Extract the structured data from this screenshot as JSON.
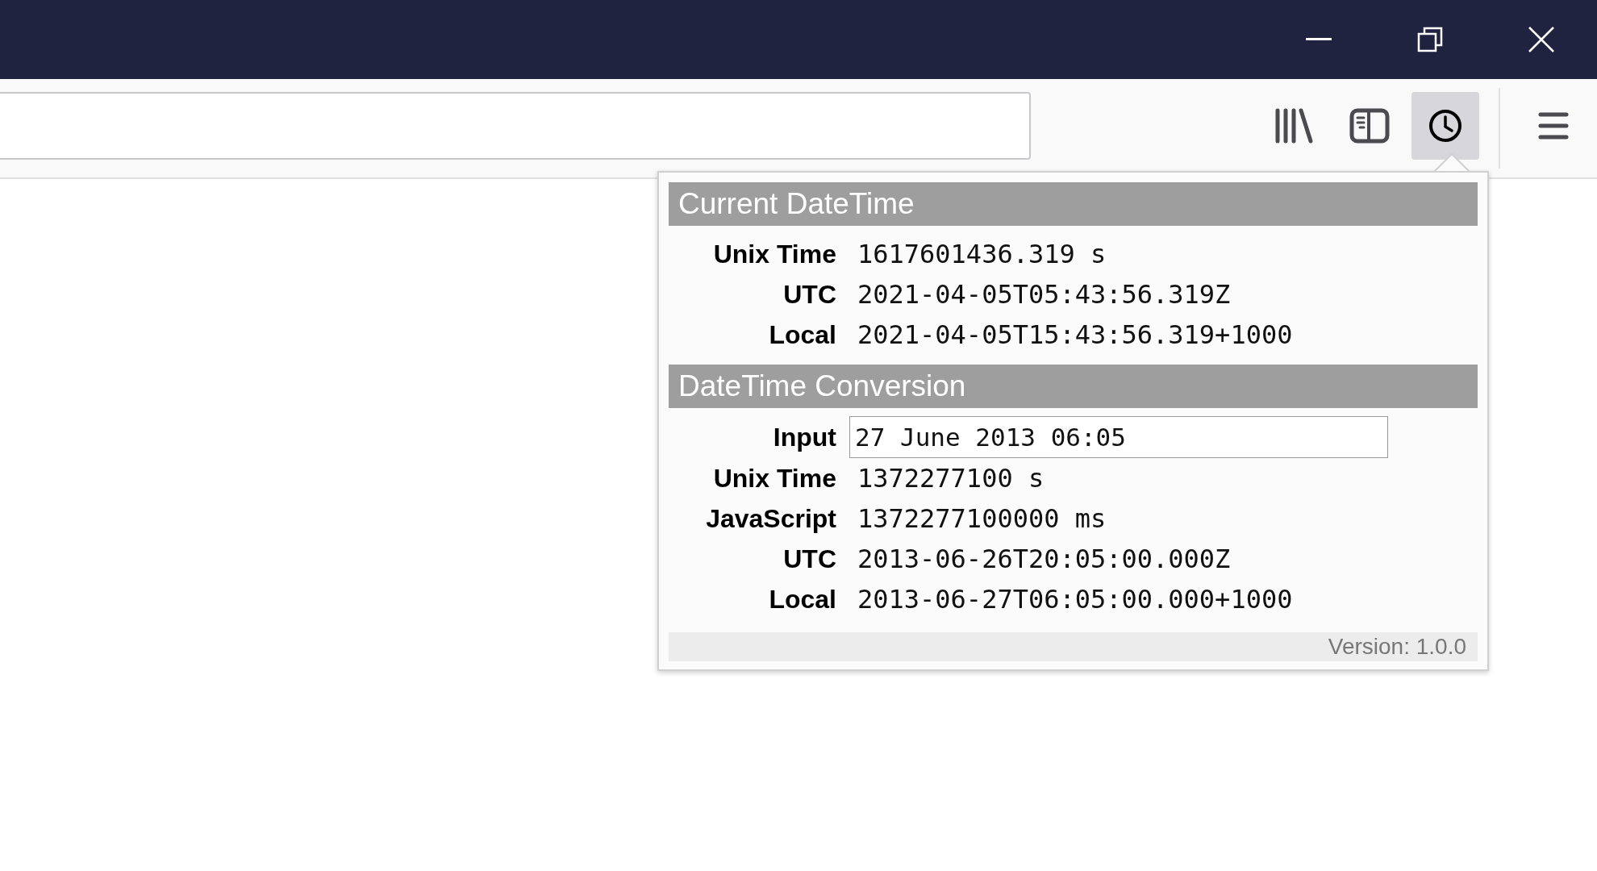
{
  "toolbar": {
    "buttons": [
      {
        "kind": "library",
        "selected": false
      },
      {
        "kind": "sidebar",
        "selected": false
      },
      {
        "kind": "clock",
        "selected": true
      }
    ]
  },
  "popup": {
    "sections": [
      {
        "title": "Current DateTime",
        "rows": [
          {
            "kind": "text",
            "label": "Unix Time",
            "value": "1617601436.319 s"
          },
          {
            "kind": "text",
            "label": "UTC",
            "value": "2021-04-05T05:43:56.319Z"
          },
          {
            "kind": "text",
            "label": "Local",
            "value": "2021-04-05T15:43:56.319+1000"
          }
        ]
      },
      {
        "title": "DateTime Conversion",
        "rows": [
          {
            "kind": "input",
            "label": "Input",
            "value": "27 June 2013 06:05"
          },
          {
            "kind": "text",
            "label": "Unix Time",
            "value": "1372277100 s"
          },
          {
            "kind": "text",
            "label": "JavaScript",
            "value": "1372277100000 ms"
          },
          {
            "kind": "text",
            "label": "UTC",
            "value": "2013-06-26T20:05:00.000Z"
          },
          {
            "kind": "text",
            "label": "Local",
            "value": "2013-06-27T06:05:00.000+1000"
          }
        ]
      }
    ],
    "version": "Version: 1.0.0"
  }
}
